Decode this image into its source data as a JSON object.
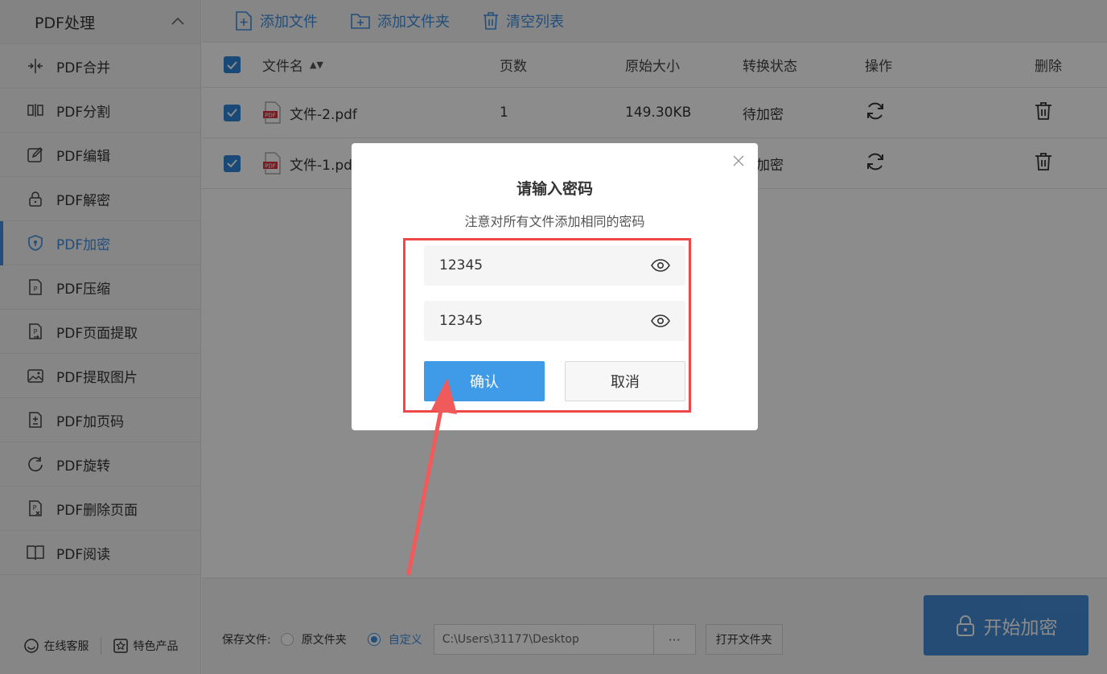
{
  "sidebar": {
    "header": "PDF处理",
    "items": [
      {
        "label": "PDF合并",
        "icon": "merge-icon"
      },
      {
        "label": "PDF分割",
        "icon": "split-icon"
      },
      {
        "label": "PDF编辑",
        "icon": "edit-icon"
      },
      {
        "label": "PDF解密",
        "icon": "unlock-icon"
      },
      {
        "label": "PDF加密",
        "icon": "shield-icon"
      },
      {
        "label": "PDF压缩",
        "icon": "compress-icon"
      },
      {
        "label": "PDF页面提取",
        "icon": "extract-page-icon"
      },
      {
        "label": "PDF提取图片",
        "icon": "image-icon"
      },
      {
        "label": "PDF加页码",
        "icon": "page-number-icon"
      },
      {
        "label": "PDF旋转",
        "icon": "rotate-icon"
      },
      {
        "label": "PDF删除页面",
        "icon": "delete-page-icon"
      },
      {
        "label": "PDF阅读",
        "icon": "book-icon"
      }
    ],
    "footer": {
      "service": "在线客服",
      "products": "特色产品"
    }
  },
  "toolbar": {
    "add_file": "添加文件",
    "add_folder": "添加文件夹",
    "clear": "清空列表"
  },
  "table": {
    "headers": {
      "name": "文件名",
      "pages": "页数",
      "size": "原始大小",
      "status": "转换状态",
      "op": "操作",
      "del": "删除"
    },
    "rows": [
      {
        "name": "文件-2.pdf",
        "pages": "1",
        "size": "149.30KB",
        "status": "待加密"
      },
      {
        "name": "文件-1.pdf",
        "pages": "",
        "size": "",
        "status": "待加密"
      }
    ]
  },
  "bottom": {
    "save_label": "保存文件:",
    "option_original": "原文件夹",
    "option_custom": "自定义",
    "path": "C:\\Users\\31177\\Desktop",
    "dots": "···",
    "open_folder": "打开文件夹",
    "start": "开始加密"
  },
  "dialog": {
    "title": "请输入密码",
    "subtitle": "注意对所有文件添加相同的密码",
    "password1": "12345",
    "password2": "12345",
    "ok": "确认",
    "cancel": "取消"
  },
  "colors": {
    "accent": "#3d8ee0",
    "highlight": "#ee4747"
  }
}
